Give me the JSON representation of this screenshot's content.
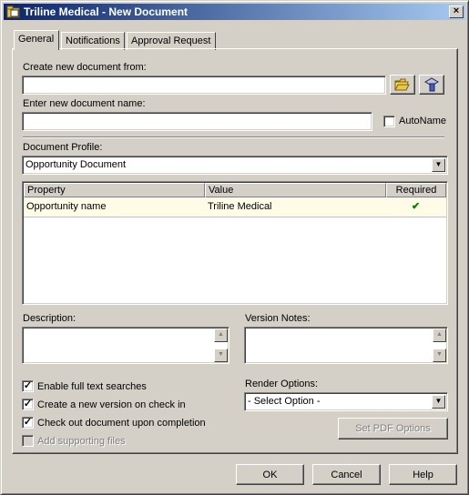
{
  "window": {
    "title": "Triline Medical - New Document",
    "close_glyph": "×"
  },
  "tabs": [
    {
      "label": "General",
      "active": true
    },
    {
      "label": "Notifications",
      "active": false
    },
    {
      "label": "Approval Request",
      "active": false
    }
  ],
  "create_from": {
    "label": "Create new document from:",
    "value": ""
  },
  "document_name": {
    "label": "Enter new document name:",
    "value": ""
  },
  "autoname": {
    "label": "AutoName",
    "checked": false
  },
  "profile": {
    "label": "Document Profile:",
    "selected": "Opportunity Document"
  },
  "properties": {
    "columns": [
      "Property",
      "Value",
      "Required"
    ],
    "rows": [
      {
        "property": "Opportunity name",
        "value": "Triline Medical",
        "required": "✔"
      }
    ]
  },
  "description": {
    "label": "Description:",
    "value": ""
  },
  "version_notes": {
    "label": "Version Notes:",
    "value": ""
  },
  "options": [
    {
      "label": "Enable full text searches",
      "checked": true,
      "enabled": true
    },
    {
      "label": "Create a new version on check in",
      "checked": true,
      "enabled": true
    },
    {
      "label": "Check out document upon completion",
      "checked": true,
      "enabled": true
    },
    {
      "label": "Add supporting files",
      "checked": false,
      "enabled": false
    }
  ],
  "render_options": {
    "label": "Render Options:",
    "selected": "- Select Option -"
  },
  "set_pdf_label": "Set PDF Options",
  "footer": {
    "ok": "OK",
    "cancel": "Cancel",
    "help": "Help"
  },
  "check_glyph": "✓",
  "colors": {
    "title_start": "#0a246a",
    "title_end": "#a6caf0",
    "row_highlight": "#fefbe6",
    "required_check": "#008000"
  }
}
